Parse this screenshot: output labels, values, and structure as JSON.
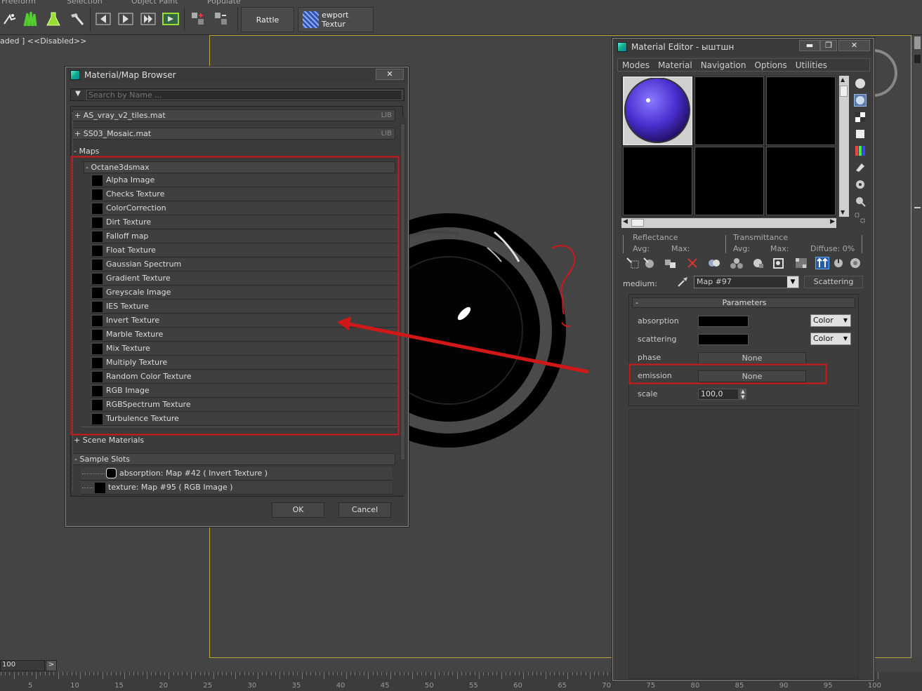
{
  "ribbon": {
    "tabs": [
      "Freeform",
      "Selection",
      "Object Paint",
      "Populate"
    ],
    "rattle_label": "Rattle",
    "viewport_texture_label": "ewport Textur"
  },
  "status": {
    "disabled_text": "aded ]  <<Disabled>>"
  },
  "timeline": {
    "frame_value": "100",
    "next_symbol": ">",
    "ticks": [
      "5",
      "10",
      "15",
      "20",
      "25",
      "30",
      "35",
      "40",
      "45",
      "50",
      "55",
      "60",
      "65",
      "70",
      "75",
      "80",
      "85",
      "90",
      "95",
      "100"
    ]
  },
  "browser": {
    "title": "Material/Map Browser",
    "close_symbol": "✕",
    "search_placeholder": "Search by Name ...",
    "groups": [
      {
        "label": "+ AS_vray_v2_tiles.mat",
        "tag": "LIB"
      },
      {
        "label": "+ SS03_Mosaic.mat",
        "tag": "LIB"
      }
    ],
    "maps_label": "- Maps",
    "octane_label": "- Octane3dsmax",
    "map_items": [
      "Alpha Image",
      "Checks Texture",
      "ColorCorrection",
      "Dirt Texture",
      "Falloff map",
      "Float Texture",
      "Gaussian Spectrum",
      "Gradient Texture",
      "Greyscale Image",
      "IES Texture",
      "Invert Texture",
      "Marble Texture",
      "Mix Texture",
      "Multiply Texture",
      "Random Color Texture",
      "RGB Image",
      "RGBSpectrum Texture",
      "Turbulence Texture"
    ],
    "scene_materials_label": "+ Scene Materials",
    "sample_slots_label": "- Sample Slots",
    "sample_slots": [
      "absorption: Map #42  ( Invert Texture )",
      "texture: Map #95  ( RGB Image )"
    ],
    "ok_label": "OK",
    "cancel_label": "Cancel"
  },
  "editor": {
    "title": "Material Editor - ыштшн",
    "minimize_symbol": "▬",
    "maximize_symbol": "❐",
    "close_symbol": "✕",
    "menu": [
      "Modes",
      "Material",
      "Navigation",
      "Options",
      "Utilities"
    ],
    "reflectance_label": "Reflectance",
    "transmittance_label": "Transmittance",
    "avg_label": "Avg:",
    "max_label": "Max:",
    "diffuse_label": "Diffuse:  0%",
    "medium_label": "medium:",
    "medium_value": "Map #97",
    "scattering_button": "Scattering",
    "params_title": "Parameters",
    "params_collapse": "-",
    "absorption_label": "absorption",
    "scattering_label": "scattering",
    "phase_label": "phase",
    "emission_label": "emission",
    "scale_label": "scale",
    "color_option": "Color",
    "none_label": "None",
    "scale_value": "100,0"
  },
  "colors": {
    "annotation_red": "#d01818",
    "viewport_border": "#b9a53d"
  }
}
